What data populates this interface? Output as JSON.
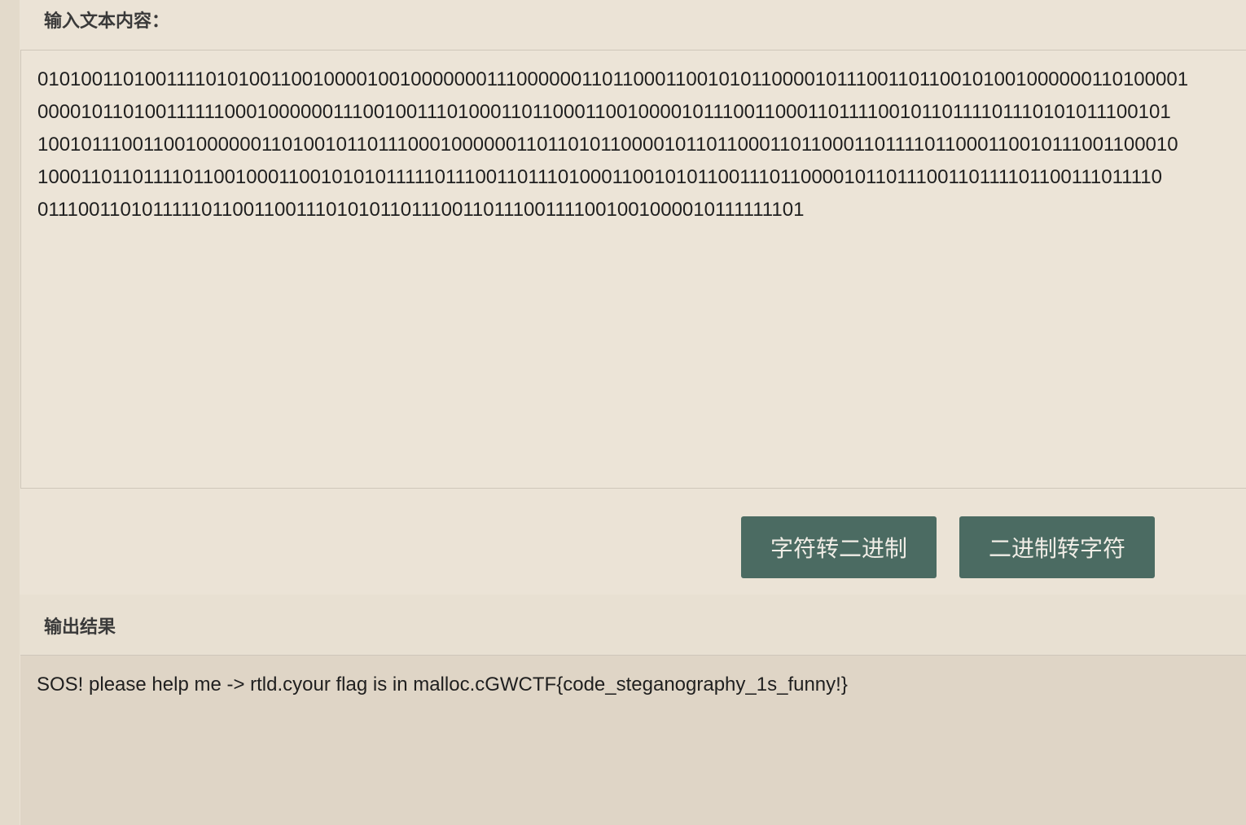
{
  "input": {
    "label": "输入文本内容：",
    "lines": [
      "010100110100111101010011001000010010000000111000000110110001100101011000010111001101100101001000000110100001",
      "000010110100111111000100000011100100111010001101100011001000010111001100011011110010110111101110101011100101",
      "100101110011001000000110100101101110001000000110110101100001011011000110110001101111011000110010111001100010",
      "100011011011110110010001100101010111110111001101110100011001010110011101100001011011100110111101100111011110",
      "01110011010111110110011001110101011011100110111001111001001000010111111101"
    ]
  },
  "buttons": {
    "to_binary": "字符转二进制",
    "to_char": "二进制转字符"
  },
  "output": {
    "label": "输出结果",
    "text": "SOS! please help me -> rtld.cyour flag is in malloc.cGWCTF{code_steganography_1s_funny!}"
  }
}
